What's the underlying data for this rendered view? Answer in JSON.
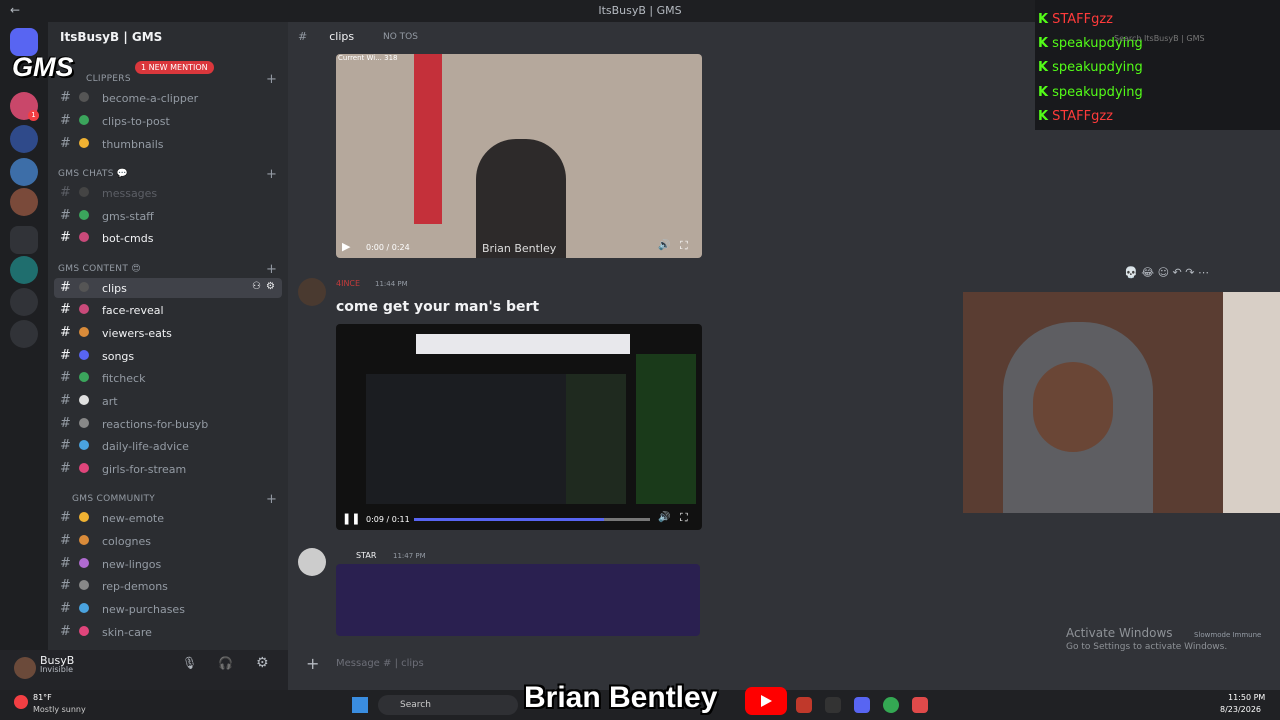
{
  "window": {
    "title": "ItsBusyB | GMS"
  },
  "server": {
    "name": "ItsBusyB | GMS",
    "logo": "GMS",
    "mention_badge": "1 NEW MENTION"
  },
  "categories": [
    {
      "label": "CLIPPERS"
    },
    {
      "label": "GMS CHATS 💬"
    },
    {
      "label": "GMS CONTENT 😍"
    },
    {
      "label": "GMS COMMUNITY"
    }
  ],
  "channels": [
    {
      "label": "become-a-clipper"
    },
    {
      "label": "clips-to-post"
    },
    {
      "label": "thumbnails"
    },
    {
      "label": "messages"
    },
    {
      "label": "gms-staff"
    },
    {
      "label": "bot-cmds"
    },
    {
      "label": "clips"
    },
    {
      "label": "face-reveal"
    },
    {
      "label": "viewers-eats"
    },
    {
      "label": "songs"
    },
    {
      "label": "fitcheck"
    },
    {
      "label": "art"
    },
    {
      "label": "reactions-for-busyb"
    },
    {
      "label": "daily-life-advice"
    },
    {
      "label": "girls-for-stream"
    },
    {
      "label": "new-emote"
    },
    {
      "label": "colognes"
    },
    {
      "label": "new-lingos"
    },
    {
      "label": "rep-demons"
    },
    {
      "label": "new-purchases"
    },
    {
      "label": "skin-care"
    }
  ],
  "header": {
    "channel": "clips",
    "topic": "NO TOS"
  },
  "user": {
    "name": "BusyB",
    "status": "Invisible"
  },
  "messages": [
    {
      "video_time": "0:00 / 0:24",
      "watermark": "Brian Bentley",
      "overlay": "Current Wi... 318"
    },
    {
      "author": "4INCE",
      "time": "11:44 PM",
      "text": "come get your man's bert",
      "video_time": "0:09 / 0:11"
    },
    {
      "author": "STAR",
      "time": "11:47 PM"
    }
  ],
  "composer": {
    "placeholder": "Message # | clips"
  },
  "stream_chat": [
    {
      "user": "STAFFgzz",
      "color": "#ff3b3b"
    },
    {
      "user": "speakupdying",
      "color": "#53fc18"
    },
    {
      "user": "speakupdying",
      "color": "#53fc18"
    },
    {
      "user": "speakupdying",
      "color": "#53fc18"
    },
    {
      "user": "STAFFgzz",
      "color": "#ff3b3b"
    }
  ],
  "search": {
    "placeholder": "Search ItsBusyB | GMS"
  },
  "windows_notice": {
    "title": "Activate Windows",
    "subtitle": "Go to Settings to activate Windows.",
    "slowmode": "Slowmode Immune"
  },
  "taskbar": {
    "temp": "81°F",
    "weather": "Mostly sunny",
    "search": "Search",
    "time": "11:50 PM",
    "date": "8/23/2026"
  },
  "overlay_banner": {
    "text": "Brian Bentley"
  }
}
